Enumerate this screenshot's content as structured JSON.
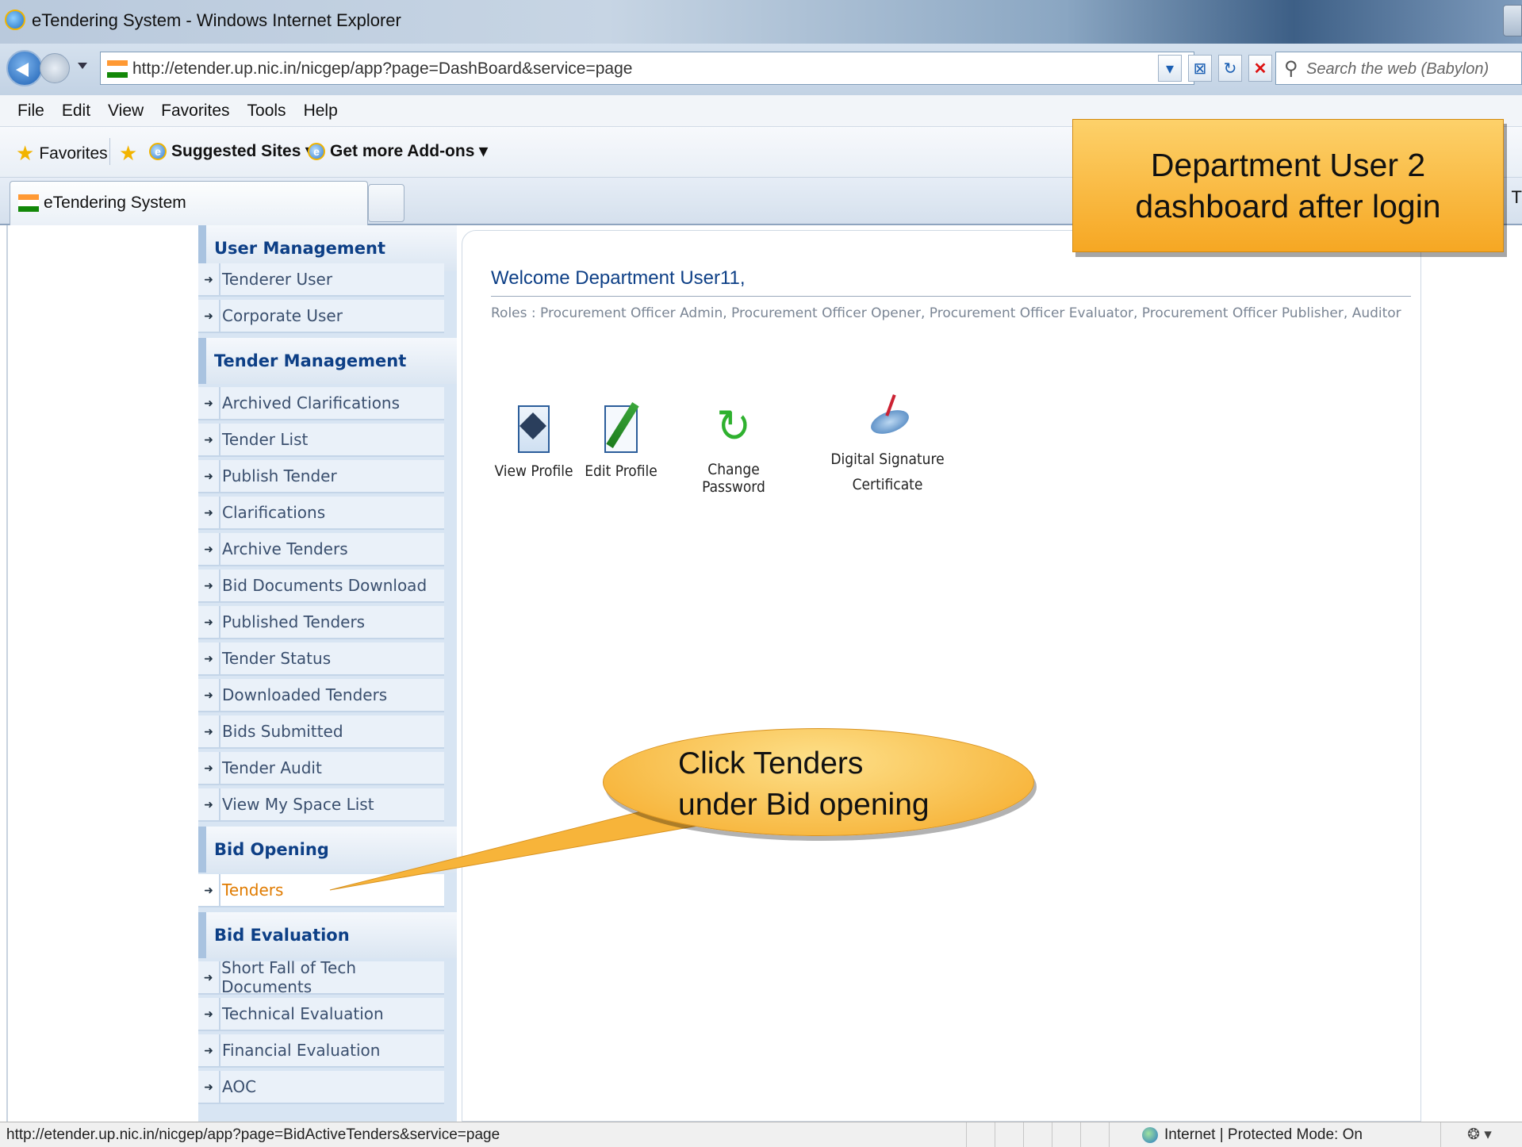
{
  "window": {
    "title": "eTendering System - Windows Internet Explorer"
  },
  "address": {
    "url": "http://etender.up.nic.in/nicgep/app?page=DashBoard&service=page",
    "search_placeholder": "Search the web (Babylon)"
  },
  "menu": [
    "File",
    "Edit",
    "View",
    "Favorites",
    "Tools",
    "Help"
  ],
  "favorites_bar": {
    "favorites": "Favorites",
    "suggested": "Suggested Sites ▾",
    "addons": "Get more Add-ons ▾"
  },
  "tab": {
    "label": "eTendering System",
    "edge_text": "T"
  },
  "sidebar": {
    "sections": [
      {
        "title": "User Management",
        "items": [
          "Tenderer User",
          "Corporate User"
        ]
      },
      {
        "title": "Tender Management",
        "items": [
          "Archived Clarifications",
          "Tender List",
          "Publish Tender",
          "Clarifications",
          "Archive Tenders",
          "Bid Documents Download",
          "Published Tenders",
          "Tender Status",
          "Downloaded Tenders",
          "Bids Submitted",
          "Tender Audit",
          "View My Space List"
        ]
      },
      {
        "title": "Bid Opening",
        "items": [
          "Tenders"
        ]
      },
      {
        "title": "Bid Evaluation",
        "items": [
          "Short Fall of Tech Documents",
          "Technical Evaluation",
          "Financial Evaluation",
          "AOC"
        ]
      }
    ],
    "active_item": "Tenders"
  },
  "main": {
    "welcome": "Welcome Department User11,",
    "roles": "Roles : Procurement Officer Admin, Procurement Officer Opener, Procurement Officer Evaluator, Procurement Officer Publisher, Auditor",
    "quick_links": [
      {
        "label": "View Profile",
        "icon": "profile-icon"
      },
      {
        "label": "Edit Profile",
        "icon": "edit-icon"
      },
      {
        "label": "Change Password",
        "icon": "refresh-icon"
      },
      {
        "label_line1": "Digital Signature",
        "label_line2": "Certificate",
        "icon": "signature-icon"
      }
    ]
  },
  "callouts": {
    "top_line1": "Department User 2",
    "top_line2": "dashboard after login",
    "oval_line1": "Click Tenders",
    "oval_line2": "under Bid opening"
  },
  "status": {
    "url": "http://etender.up.nic.in/nicgep/app?page=BidActiveTenders&service=page",
    "zone": "Internet | Protected Mode: On",
    "zoom": "❂ ▾"
  }
}
